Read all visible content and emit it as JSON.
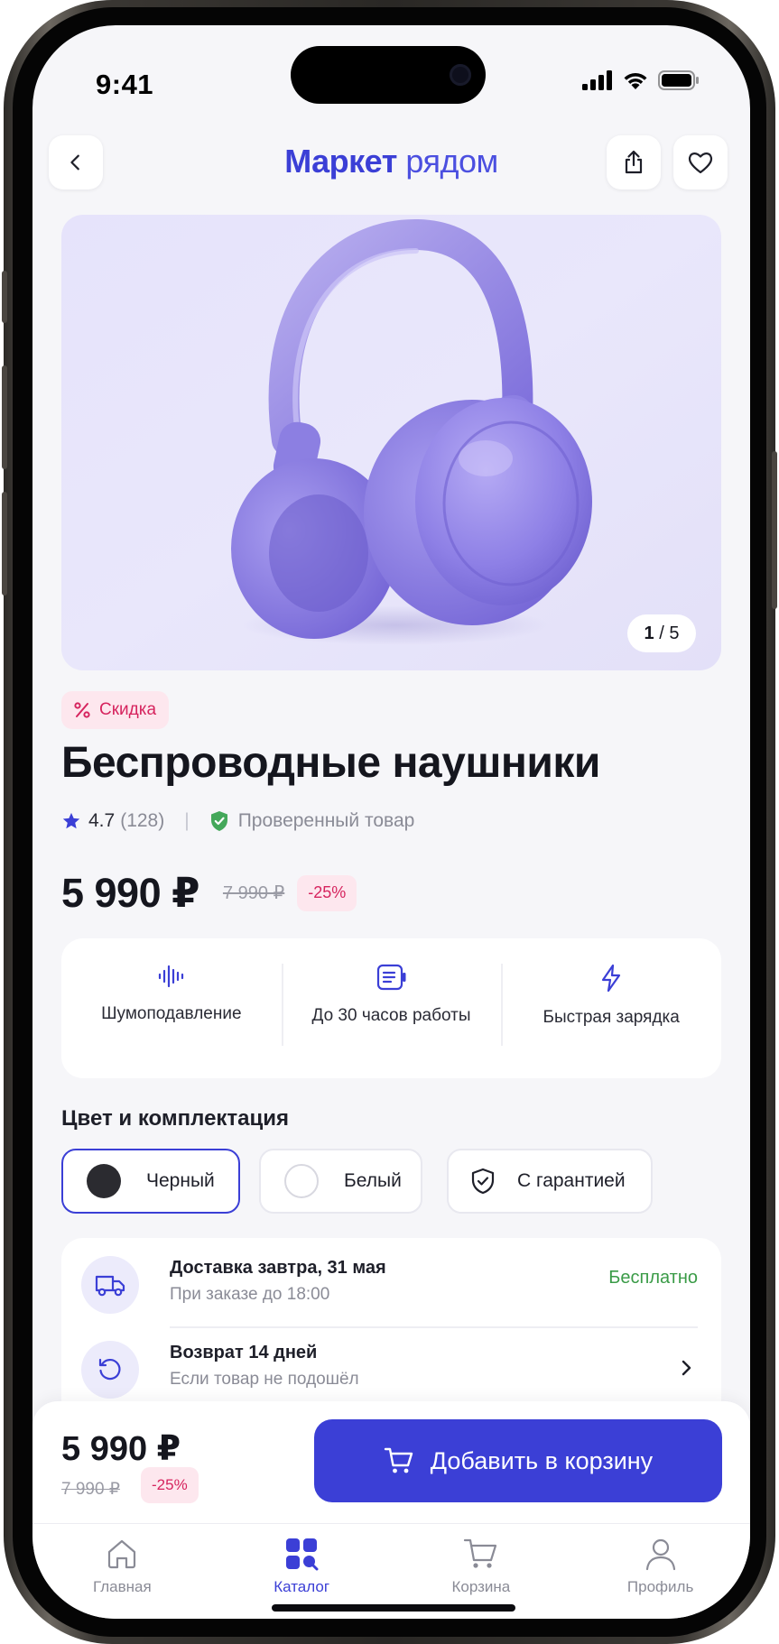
{
  "status_bar": {
    "time": "9:41"
  },
  "header": {
    "brand_part1": "Маркет",
    "brand_part2": "рядом"
  },
  "product": {
    "image_counter_current": "1",
    "image_counter_total": "/ 5",
    "badge": "Скидка",
    "title": "Беспроводные наушники",
    "rating": "4.7",
    "reviews": "(128)",
    "verified": "Проверенный товар",
    "price": "5 990 ₽",
    "old_price": "7 990 ₽",
    "discount": "-25%",
    "image_color": "#a79cec"
  },
  "features": [
    {
      "icon": "waveform-icon",
      "label": "Шумоподавление"
    },
    {
      "icon": "battery-icon",
      "label": "До 30 часов работы"
    },
    {
      "icon": "lightning-icon",
      "label": "Быстрая зарядка"
    }
  ],
  "options": {
    "title": "Цвет и комплектация",
    "items": [
      {
        "label": "Черный",
        "selected": true,
        "swatch": "#2b2b30"
      },
      {
        "label": "Белый",
        "selected": false,
        "swatch": "#ffffff"
      },
      {
        "label": "С гарантией",
        "selected": false,
        "icon": "shield-icon"
      }
    ]
  },
  "delivery": {
    "title": "Доставка завтра, 31 мая",
    "subtitle": "При заказе до 18:00",
    "cost": "Бесплатно"
  },
  "returns": {
    "title": "Возврат 14 дней",
    "subtitle": "Если товар не подошёл"
  },
  "buy_bar": {
    "price": "5 990 ₽",
    "old_price": "7 990 ₽",
    "discount": "-25%",
    "cta": "Добавить в корзину"
  },
  "tabs": [
    {
      "label": "Главная",
      "icon": "home-icon",
      "active": false
    },
    {
      "label": "Каталог",
      "icon": "catalog-icon",
      "active": true
    },
    {
      "label": "Корзина",
      "icon": "cart-icon",
      "active": false
    },
    {
      "label": "Профиль",
      "icon": "profile-icon",
      "active": false
    }
  ],
  "colors": {
    "accent": "#3b3fd6",
    "sale": "#d6245e",
    "sale_bg": "#fde7ee",
    "success": "#3a9b47"
  }
}
